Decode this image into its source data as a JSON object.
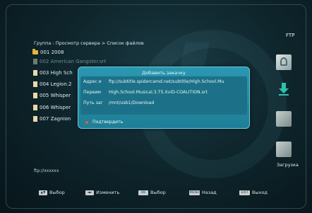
{
  "header": {
    "mode_label": "FTP"
  },
  "breadcrumb": "Группа : Просмотр сервера > Список файлов",
  "files": [
    {
      "label": "001  2008",
      "kind": "folder",
      "dimmed": false
    },
    {
      "label": "002  American Gangster.srt",
      "kind": "file",
      "dimmed": true
    },
    {
      "label": "003  High Sch",
      "kind": "file",
      "dimmed": false
    },
    {
      "label": "004  Legion.2",
      "kind": "file",
      "dimmed": false
    },
    {
      "label": "005  Whisper",
      "kind": "file",
      "dimmed": false
    },
    {
      "label": "006  Whisper",
      "kind": "file",
      "dimmed": false
    },
    {
      "label": "007  Zagnion",
      "kind": "file",
      "dimmed": false
    }
  ],
  "dialog": {
    "title": "Добавить закачку",
    "address_key": "Адрес и",
    "address_value": "ftp://subtitle.spidercamd.net/subtitle/High.School.Mu",
    "rename_key": "Переим",
    "rename_value": "High.School.Musical.3.TS.XviD-COALITION.srt",
    "path_key": "Путь заг",
    "path_value": "/mnt/usb1/Download",
    "confirm_label": "Подтвердить"
  },
  "side": {
    "icons": [
      "music-icon",
      "download-icon",
      "video-icon",
      "picture-icon"
    ],
    "download_label": "Загрузка"
  },
  "url_label": "ftp://xxxxxx",
  "bottom_bar": [
    {
      "key": "▲▼",
      "label": "Выбор"
    },
    {
      "key": "◄►",
      "label": "Изменить"
    },
    {
      "key": "OK",
      "label": "Выбор"
    },
    {
      "key": "MENU",
      "label": "Назад"
    },
    {
      "key": "EXIT",
      "label": "Выход"
    }
  ],
  "colors": {
    "accent": "#2a98b1",
    "folder": "#e8b43c",
    "confirm": "#e25a3c"
  }
}
